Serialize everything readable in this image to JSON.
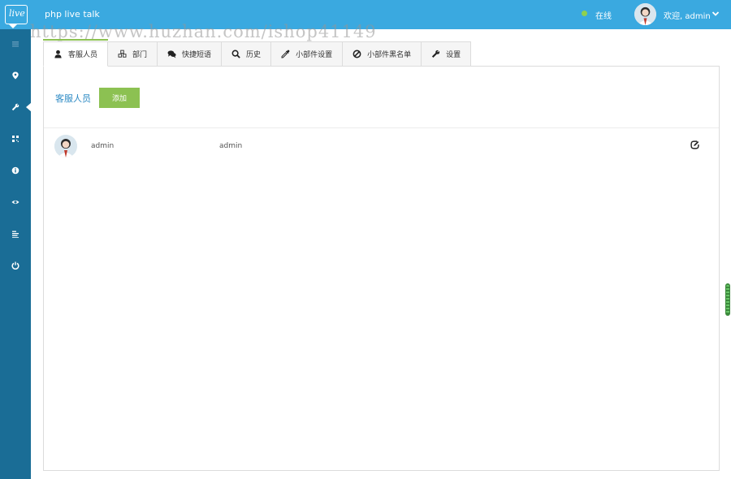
{
  "header": {
    "logo_text": "live",
    "app_title": "php live talk",
    "status_text": "在线",
    "status_color": "#8fd14f",
    "welcome_text": "欢迎, admin",
    "bar_color": "#3aa9e0"
  },
  "watermark": "https://www.huzhan.com/ishop41149",
  "sidebar": {
    "color": "#1a6d96",
    "items": [
      {
        "icon": "menu-icon"
      },
      {
        "icon": "map-marker-icon"
      },
      {
        "icon": "wrench-icon",
        "active": true
      },
      {
        "icon": "qrcode-icon"
      },
      {
        "icon": "info-icon"
      },
      {
        "icon": "eye-icon"
      },
      {
        "icon": "list-icon"
      },
      {
        "icon": "power-icon"
      }
    ]
  },
  "tabs": [
    {
      "label": "客服人员",
      "icon": "user-icon",
      "active": true
    },
    {
      "label": "部门",
      "icon": "cubes-icon"
    },
    {
      "label": "快捷短语",
      "icon": "comments-icon"
    },
    {
      "label": "历史",
      "icon": "search-icon"
    },
    {
      "label": "小部件设置",
      "icon": "eyedropper-icon"
    },
    {
      "label": "小部件黑名单",
      "icon": "ban-icon"
    },
    {
      "label": "设置",
      "icon": "wrench-icon"
    }
  ],
  "main": {
    "section_title": "客服人员",
    "add_button_label": "添加",
    "add_button_color": "#8cc152",
    "operators": [
      {
        "name": "admin",
        "nickname": "admin"
      }
    ]
  }
}
